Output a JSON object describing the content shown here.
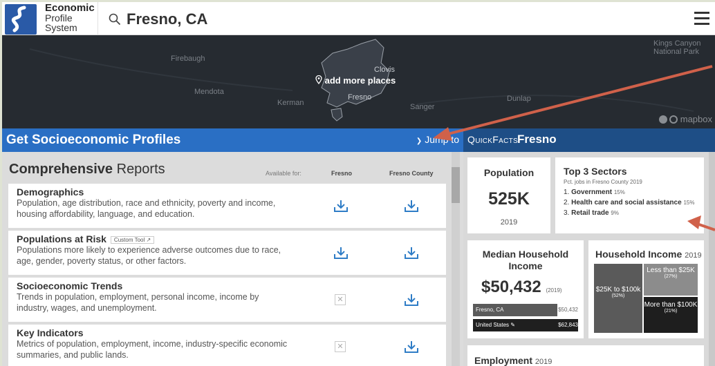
{
  "app": {
    "logo_line1": "Economic",
    "logo_line2": "Profile",
    "logo_line3": "System"
  },
  "search": {
    "value": "Fresno, CA"
  },
  "map": {
    "labels": [
      "Firebaugh",
      "Mendota",
      "Kerman",
      "Clovis",
      "Fresno",
      "Sanger",
      "Dunlap",
      "Kings Canyon",
      "National Park"
    ],
    "add_places": "add more places",
    "attribution": "mapbox"
  },
  "left": {
    "header_title": "Get Socioeconomic Profiles",
    "jump_to": "Jump to",
    "reports_bold": "Comprehensive",
    "reports_rest": " Reports",
    "available_for": "Available for:",
    "col_fresno": "Fresno",
    "col_county": "Fresno County",
    "reports": [
      {
        "title": "Demographics",
        "badge": "",
        "desc": "Population, age distribution, race and ethnicity, poverty and income, housing affordability, language, and education.",
        "fresno": "download",
        "county": "download"
      },
      {
        "title": "Populations at Risk",
        "badge": "Custom Tool",
        "desc": "Populations more likely to experience adverse outcomes due to race, age, gender, poverty status, or other factors.",
        "fresno": "download",
        "county": "download"
      },
      {
        "title": "Socioeconomic Trends",
        "badge": "",
        "desc": "Trends in population, employment, personal income, income by industry, wages, and unemployment.",
        "fresno": "unavailable",
        "county": "download"
      },
      {
        "title": "Key Indicators",
        "badge": "",
        "desc": "Metrics of population, employment, income, industry-specific economic summaries, and public lands.",
        "fresno": "unavailable",
        "county": "download"
      }
    ]
  },
  "right": {
    "quickfacts": "QuickFacts",
    "place": "Fresno",
    "population": {
      "title": "Population",
      "value": "525K",
      "year": "2019"
    },
    "sectors": {
      "title": "Top 3 Sectors",
      "subtitle": "Pct. jobs in Fresno County 2019",
      "items": [
        {
          "rank": "1.",
          "name": "Government",
          "pct": "15%"
        },
        {
          "rank": "2.",
          "name": "Health care and social assistance",
          "pct": "15%"
        },
        {
          "rank": "3.",
          "name": "Retail trade",
          "pct": "9%"
        }
      ]
    },
    "median_income": {
      "title": "Median Household Income",
      "value": "$50,432",
      "year": "(2019)",
      "bars": [
        {
          "label": "Fresno, CA",
          "value": "$50,432",
          "fraction": 0.8
        },
        {
          "label": "United States",
          "value": "$62,843",
          "fraction": 1.0
        }
      ]
    },
    "household_income": {
      "title": "Household Income",
      "year": "2019",
      "blocks": [
        {
          "label": "$25K to $100k",
          "pct": "(52%)",
          "color": "#5a5a5a"
        },
        {
          "label": "Less than $25K",
          "pct": "(27%)",
          "color": "#8c8c8c"
        },
        {
          "label": "More than $100K",
          "pct": "(21%)",
          "color": "#1e1e1e"
        }
      ]
    },
    "employment": {
      "title": "Employment",
      "year": "2019"
    }
  },
  "colors": {
    "left_header": "#2a6fc4",
    "right_header": "#1e4e86",
    "download_icon": "#2e7cc6",
    "arrow": "#d0614a"
  }
}
